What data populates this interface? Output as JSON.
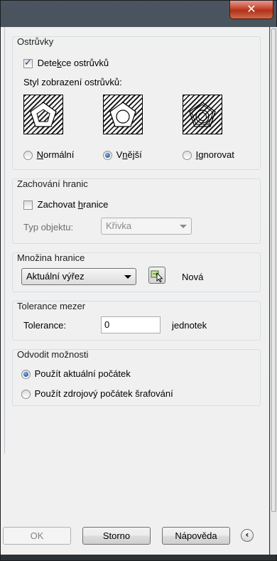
{
  "window": {
    "close_glyph": "✕"
  },
  "islands": {
    "title": "Ostrůvky",
    "detect_label_pre": "Dete",
    "detect_label_u": "k",
    "detect_label_post": "ce ostrůvků",
    "detect_checked": true,
    "style_label": "Styl zobrazení ostrůvků:",
    "options": [
      {
        "label_pre": "",
        "label_u": "N",
        "label_post": "ormální",
        "checked": false
      },
      {
        "label_pre": "V",
        "label_u": "n",
        "label_post": "ější",
        "checked": true
      },
      {
        "label_pre": "",
        "label_u": "I",
        "label_post": "gnorovat",
        "checked": false
      }
    ]
  },
  "retain": {
    "title": "Zachování hranic",
    "checkbox_pre": "Zachovat ",
    "checkbox_u": "h",
    "checkbox_post": "ranice",
    "checked": false,
    "object_type_label": "Typ objektu:",
    "object_type_value": "Křivka"
  },
  "boundary_set": {
    "title": "Množina hranice",
    "selected": "Aktuální výřez",
    "new_label": "Nová",
    "pick_icon": "select-objects-icon"
  },
  "gap": {
    "title": "Tolerance mezer",
    "label": "Tolerance:",
    "value": "0",
    "units": "jednotek"
  },
  "inherit": {
    "title": "Odvodit možnosti",
    "option1": "Použít aktuální počátek",
    "option2": "Použít zdrojový počátek šrafování",
    "selected_index": 0
  },
  "buttons": {
    "ok": "OK",
    "cancel": "Storno",
    "help": "Nápověda",
    "collapse_glyph": "‹"
  }
}
